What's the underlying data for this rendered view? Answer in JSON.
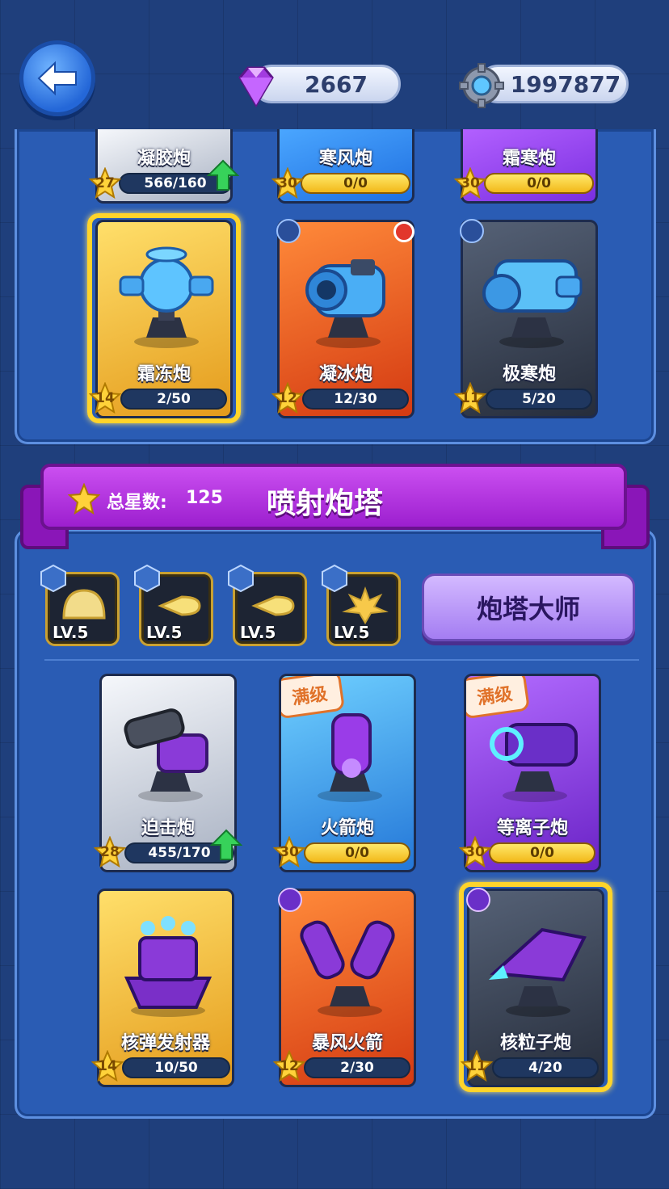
{
  "resources": {
    "gems": "2667",
    "gears": "1997877"
  },
  "top_cards": [
    {
      "name": "凝胶炮",
      "level": "27",
      "progress": "566/160",
      "style": "silver",
      "upgrade": true
    },
    {
      "name": "寒风炮",
      "level": "30",
      "progress": "0/0",
      "style": "blue-solid"
    },
    {
      "name": "霜寒炮",
      "level": "30",
      "progress": "0/0",
      "style": "purple-solid"
    }
  ],
  "ice_cards": [
    {
      "name": "霜冻炮",
      "level": "14",
      "progress": "2/50",
      "style": "gold",
      "selected": true
    },
    {
      "name": "凝冰炮",
      "level": "12",
      "progress": "12/30",
      "style": "orange",
      "badge": "snowflake-icon",
      "notice": true
    },
    {
      "name": "极寒炮",
      "level": "11",
      "progress": "5/20",
      "style": "dark",
      "badge": "snowflake-icon"
    }
  ],
  "section": {
    "stars_label": "总星数:",
    "stars_value": "125",
    "title": "喷射炮塔"
  },
  "skills": [
    {
      "level": "LV.5",
      "icon": "dome-icon"
    },
    {
      "level": "LV.5",
      "icon": "bullet-icon"
    },
    {
      "level": "LV.5",
      "icon": "bullet-icon"
    },
    {
      "level": "LV.5",
      "icon": "explosion-icon"
    }
  ],
  "master_button": "炮塔大师",
  "jet_cards_row1": [
    {
      "name": "迫击炮",
      "level": "28",
      "progress": "455/170",
      "style": "silver",
      "upgrade": true
    },
    {
      "name": "火箭炮",
      "level": "30",
      "progress": "0/0",
      "style": "blue",
      "max_tag": "满级"
    },
    {
      "name": "等离子炮",
      "level": "30",
      "progress": "0/0",
      "style": "purple",
      "max_tag": "满级"
    }
  ],
  "jet_cards_row2": [
    {
      "name": "核弹发射器",
      "level": "14",
      "progress": "10/50",
      "style": "gold"
    },
    {
      "name": "暴风火箭",
      "level": "12",
      "progress": "2/30",
      "style": "orange",
      "badge": "crosshair-icon"
    },
    {
      "name": "核粒子炮",
      "level": "11",
      "progress": "4/20",
      "style": "dark",
      "badge": "crosshair-icon",
      "selected": true
    }
  ],
  "colors": {
    "accent": "#9c1fcf",
    "panel": "#2a5cb4",
    "gold": "#ffd42a"
  }
}
